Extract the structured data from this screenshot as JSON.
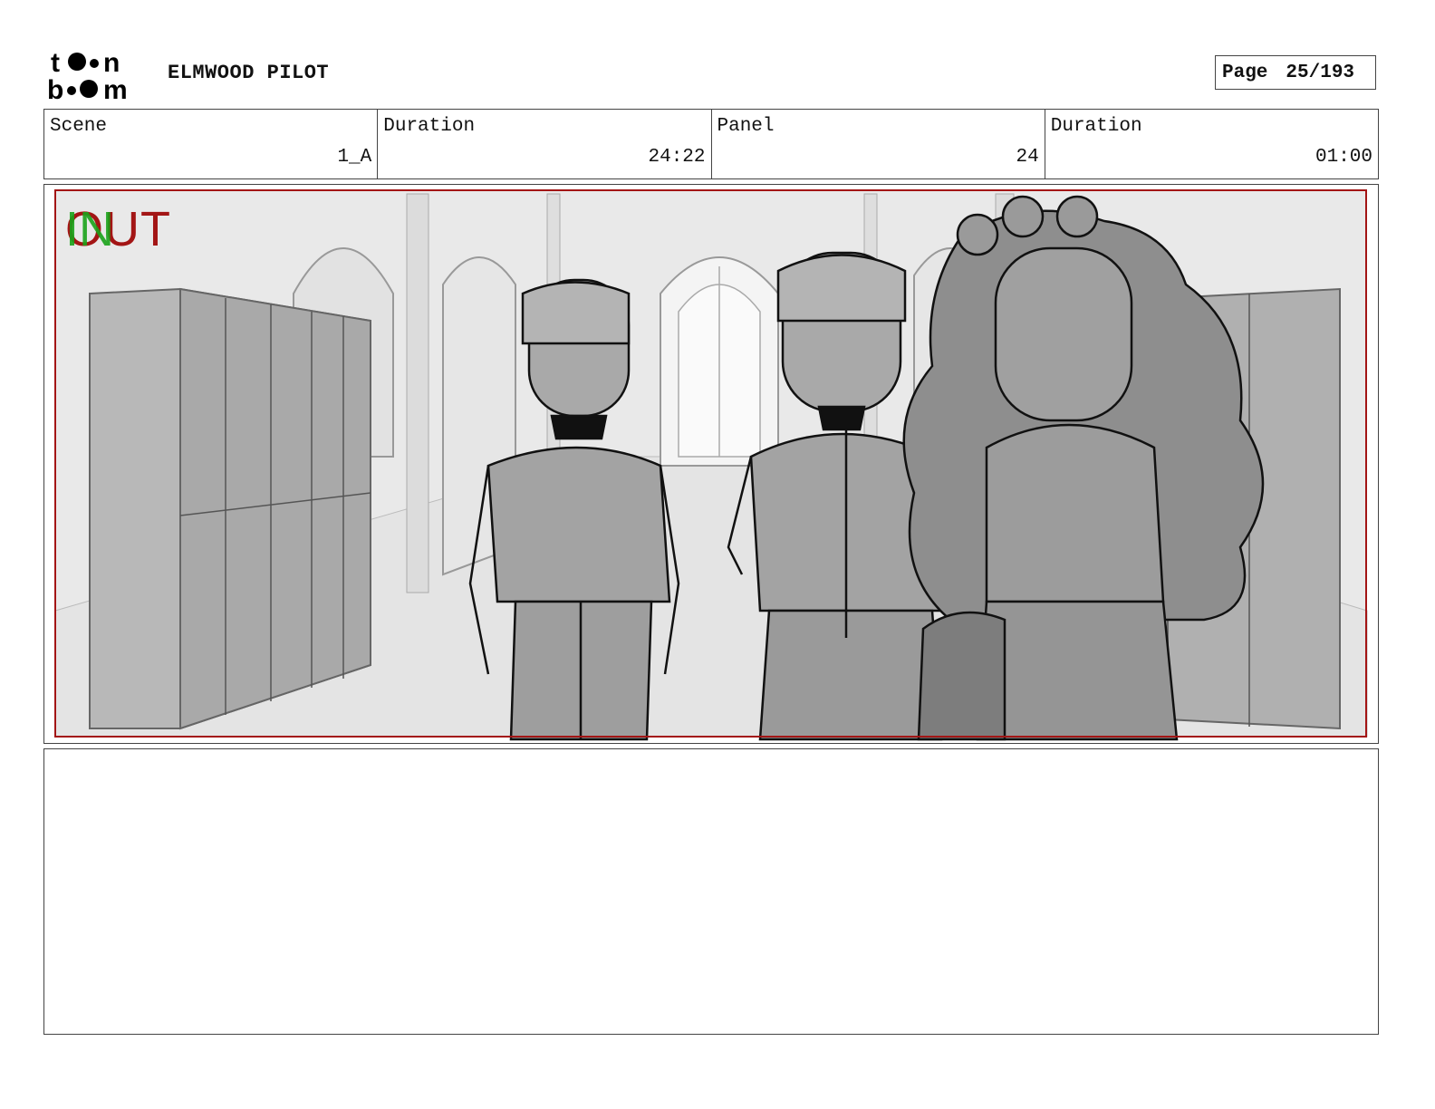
{
  "header": {
    "logo_alt": "toon boom",
    "project_title": "ELMWOOD PILOT",
    "page_label": "Page",
    "page_value": "25/193"
  },
  "info": {
    "scene_label": "Scene",
    "scene_value": "1_A",
    "scene_duration_label": "Duration",
    "scene_duration_value": "24:22",
    "panel_label": "Panel",
    "panel_value": "24",
    "panel_duration_label": "Duration",
    "panel_duration_value": "01:00"
  },
  "panel": {
    "in_marker": "IN",
    "out_marker": "OUT"
  },
  "notes": {
    "text": ""
  },
  "colors": {
    "frame_red": "#a31515",
    "in_green": "#1aa31a"
  }
}
